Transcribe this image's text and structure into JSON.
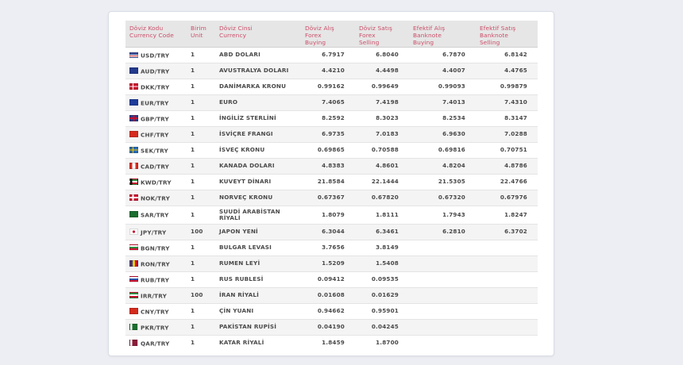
{
  "table": {
    "headers": [
      {
        "line1": "Döviz Kodu",
        "line2": "Currency Code",
        "line3": ""
      },
      {
        "line1": "Birim",
        "line2": "Unit",
        "line3": ""
      },
      {
        "line1": "Döviz Cinsi",
        "line2": "Currency",
        "line3": ""
      },
      {
        "line1": "Döviz Alış",
        "line2": "Forex",
        "line3": "Buying"
      },
      {
        "line1": "Döviz Satış",
        "line2": "Forex",
        "line3": "Selling"
      },
      {
        "line1": "Efektif Alış",
        "line2": "Banknote",
        "line3": "Buying"
      },
      {
        "line1": "Efektif Satış",
        "line2": "Banknote",
        "line3": "Selling"
      }
    ],
    "rows": [
      {
        "flag": "us-flag-icon",
        "code": "USD/TRY",
        "unit": "1",
        "currency": "ABD DOLARI",
        "forex_buying": "6.7917",
        "forex_selling": "6.8040",
        "banknote_buying": "6.7870",
        "banknote_selling": "6.8142"
      },
      {
        "flag": "au-flag-icon",
        "code": "AUD/TRY",
        "unit": "1",
        "currency": "AVUSTRALYA DOLARI",
        "forex_buying": "4.4210",
        "forex_selling": "4.4498",
        "banknote_buying": "4.4007",
        "banknote_selling": "4.4765"
      },
      {
        "flag": "dk-flag-icon",
        "code": "DKK/TRY",
        "unit": "1",
        "currency": "DANİMARKA KRONU",
        "forex_buying": "0.99162",
        "forex_selling": "0.99649",
        "banknote_buying": "0.99093",
        "banknote_selling": "0.99879"
      },
      {
        "flag": "eu-flag-icon",
        "code": "EUR/TRY",
        "unit": "1",
        "currency": "EURO",
        "forex_buying": "7.4065",
        "forex_selling": "7.4198",
        "banknote_buying": "7.4013",
        "banknote_selling": "7.4310"
      },
      {
        "flag": "gb-flag-icon",
        "code": "GBP/TRY",
        "unit": "1",
        "currency": "İNGİLİZ STERLİNİ",
        "forex_buying": "8.2592",
        "forex_selling": "8.3023",
        "banknote_buying": "8.2534",
        "banknote_selling": "8.3147"
      },
      {
        "flag": "ch-flag-icon",
        "code": "CHF/TRY",
        "unit": "1",
        "currency": "İSVİÇRE FRANGI",
        "forex_buying": "6.9735",
        "forex_selling": "7.0183",
        "banknote_buying": "6.9630",
        "banknote_selling": "7.0288"
      },
      {
        "flag": "se-flag-icon",
        "code": "SEK/TRY",
        "unit": "1",
        "currency": "İSVEÇ KRONU",
        "forex_buying": "0.69865",
        "forex_selling": "0.70588",
        "banknote_buying": "0.69816",
        "banknote_selling": "0.70751"
      },
      {
        "flag": "ca-flag-icon",
        "code": "CAD/TRY",
        "unit": "1",
        "currency": "KANADA DOLARI",
        "forex_buying": "4.8383",
        "forex_selling": "4.8601",
        "banknote_buying": "4.8204",
        "banknote_selling": "4.8786"
      },
      {
        "flag": "kw-flag-icon",
        "code": "KWD/TRY",
        "unit": "1",
        "currency": "KUVEYT DİNARI",
        "forex_buying": "21.8584",
        "forex_selling": "22.1444",
        "banknote_buying": "21.5305",
        "banknote_selling": "22.4766"
      },
      {
        "flag": "no-flag-icon",
        "code": "NOK/TRY",
        "unit": "1",
        "currency": "NORVEÇ KRONU",
        "forex_buying": "0.67367",
        "forex_selling": "0.67820",
        "banknote_buying": "0.67320",
        "banknote_selling": "0.67976"
      },
      {
        "flag": "sa-flag-icon",
        "code": "SAR/TRY",
        "unit": "1",
        "currency": "SUUDİ ARABİSTAN RİYALİ",
        "forex_buying": "1.8079",
        "forex_selling": "1.8111",
        "banknote_buying": "1.7943",
        "banknote_selling": "1.8247"
      },
      {
        "flag": "jp-flag-icon",
        "code": "JPY/TRY",
        "unit": "100",
        "currency": "JAPON YENİ",
        "forex_buying": "6.3044",
        "forex_selling": "6.3461",
        "banknote_buying": "6.2810",
        "banknote_selling": "6.3702"
      },
      {
        "flag": "bg-flag-icon",
        "code": "BGN/TRY",
        "unit": "1",
        "currency": "BULGAR LEVASI",
        "forex_buying": "3.7656",
        "forex_selling": "3.8149",
        "banknote_buying": "",
        "banknote_selling": ""
      },
      {
        "flag": "ro-flag-icon",
        "code": "RON/TRY",
        "unit": "1",
        "currency": "RUMEN LEYİ",
        "forex_buying": "1.5209",
        "forex_selling": "1.5408",
        "banknote_buying": "",
        "banknote_selling": ""
      },
      {
        "flag": "ru-flag-icon",
        "code": "RUB/TRY",
        "unit": "1",
        "currency": "RUS RUBLESİ",
        "forex_buying": "0.09412",
        "forex_selling": "0.09535",
        "banknote_buying": "",
        "banknote_selling": ""
      },
      {
        "flag": "ir-flag-icon",
        "code": "IRR/TRY",
        "unit": "100",
        "currency": "İRAN RİYALİ",
        "forex_buying": "0.01608",
        "forex_selling": "0.01629",
        "banknote_buying": "",
        "banknote_selling": ""
      },
      {
        "flag": "cn-flag-icon",
        "code": "CNY/TRY",
        "unit": "1",
        "currency": "ÇİN YUANI",
        "forex_buying": "0.94662",
        "forex_selling": "0.95901",
        "banknote_buying": "",
        "banknote_selling": ""
      },
      {
        "flag": "pk-flag-icon",
        "code": "PKR/TRY",
        "unit": "1",
        "currency": "PAKİSTAN RUPİSİ",
        "forex_buying": "0.04190",
        "forex_selling": "0.04245",
        "banknote_buying": "",
        "banknote_selling": ""
      },
      {
        "flag": "qa-flag-icon",
        "code": "QAR/TRY",
        "unit": "1",
        "currency": "KATAR RİYALİ",
        "forex_buying": "1.8459",
        "forex_selling": "1.8700",
        "banknote_buying": "",
        "banknote_selling": ""
      }
    ]
  }
}
